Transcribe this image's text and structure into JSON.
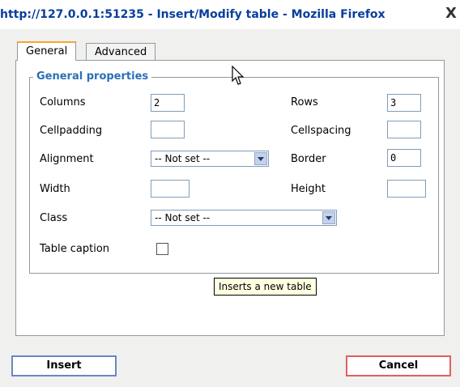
{
  "window": {
    "title": "http://127.0.0.1:51235 - Insert/Modify table - Mozilla Firefox",
    "close_glyph": "X"
  },
  "tabs": [
    {
      "label": "General",
      "active": true
    },
    {
      "label": "Advanced",
      "active": false
    }
  ],
  "general": {
    "legend": "General properties",
    "columns": {
      "label": "Columns",
      "value": "2"
    },
    "rows": {
      "label": "Rows",
      "value": "3"
    },
    "cellpadding": {
      "label": "Cellpadding",
      "value": ""
    },
    "cellspacing": {
      "label": "Cellspacing",
      "value": ""
    },
    "alignment": {
      "label": "Alignment",
      "value": "-- Not set --"
    },
    "border": {
      "label": "Border",
      "value": "0"
    },
    "width": {
      "label": "Width",
      "value": ""
    },
    "height": {
      "label": "Height",
      "value": ""
    },
    "class": {
      "label": "Class",
      "value": "-- Not set --"
    },
    "caption": {
      "label": "Table caption",
      "checked": false
    }
  },
  "tooltip": "Inserts a new table",
  "buttons": {
    "insert": "Insert",
    "cancel": "Cancel"
  },
  "icons": {
    "cursor": "mouse-pointer-icon",
    "close": "close-icon",
    "dropdown": "chevron-down-icon"
  }
}
